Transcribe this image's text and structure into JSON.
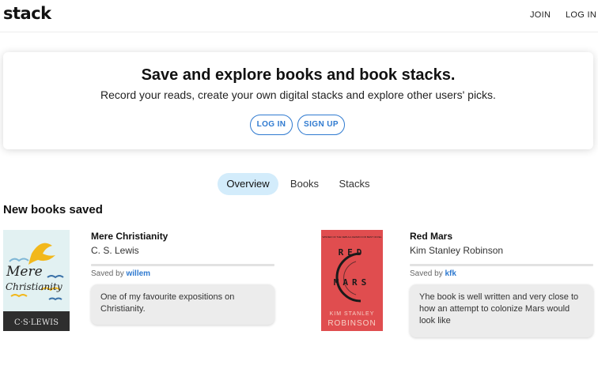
{
  "header": {
    "logo": "stack",
    "join_label": "JOIN",
    "login_label": "LOG IN"
  },
  "hero": {
    "title": "Save and explore books and book stacks.",
    "subtitle": "Record your reads, create your own digital stacks and explore other users' picks.",
    "login_button": "LOG IN",
    "signup_button": "SIGN UP"
  },
  "tabs": [
    {
      "label": "Overview",
      "active": true
    },
    {
      "label": "Books",
      "active": false
    },
    {
      "label": "Stacks",
      "active": false
    }
  ],
  "section": {
    "title": "New books saved"
  },
  "books": [
    {
      "title": "Mere Christianity",
      "author": "C. S. Lewis",
      "saved_prefix": "Saved by",
      "saved_by": "willem",
      "comment": "One of my favourite expositions on Christianity.",
      "cover": {
        "title_line1": "Mere",
        "title_line2": "Christianity",
        "author": "C·S·LEWIS",
        "colors": {
          "bg": "#e2f1f2",
          "band": "#2e2e2e",
          "bird": "#f2b81c",
          "accent": "#3b72a8"
        }
      }
    },
    {
      "title": "Red Mars",
      "author": "Kim Stanley Robinson",
      "saved_prefix": "Saved by",
      "saved_by": "kfk",
      "comment": "Yhe book is well written and very close to how an attempt to colonize Mars would look like",
      "cover": {
        "top_line": "WINNER OF THE NEBULA AWARD FOR BEST NOVEL",
        "word1": "RED",
        "word2": "MARS",
        "author_line1": "KIM STANLEY",
        "author_line2": "ROBINSON",
        "colors": {
          "bg": "#e04d4f",
          "text": "#1a1a1a",
          "author": "#f6d1c6"
        }
      }
    }
  ],
  "colors": {
    "accent": "#2f7ad0",
    "tab_active_bg": "#d3ecfb",
    "comment_bg": "#ececec"
  }
}
